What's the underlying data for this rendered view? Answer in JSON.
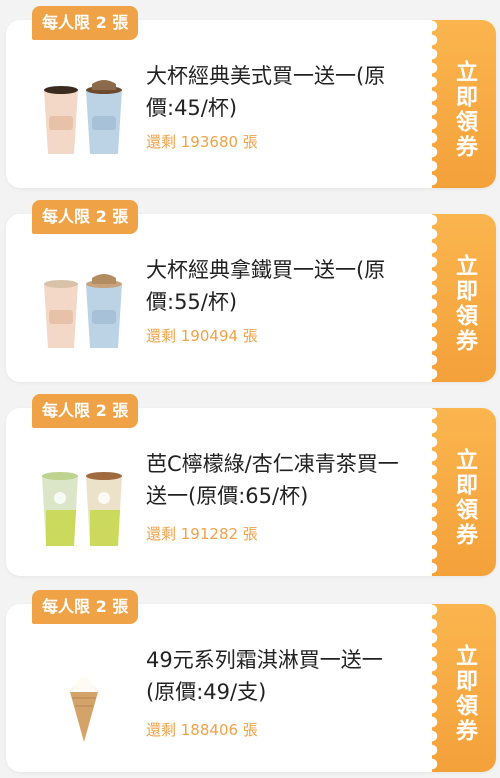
{
  "coupons": [
    {
      "badge": "每人限 2 張",
      "title": "大杯經典美式買一送一(原價:45/杯)",
      "remaining": "還剩 193680 張",
      "cta": "立即領券",
      "image_icon": "coffee-cups-icon"
    },
    {
      "badge": "每人限 2 張",
      "title": "大杯經典拿鐵買一送一(原價:55/杯)",
      "remaining": "還剩 190494 張",
      "cta": "立即領券",
      "image_icon": "latte-cups-icon"
    },
    {
      "badge": "每人限 2 張",
      "title": "芭C檸檬綠/杏仁凍青茶買一送一(原價:65/杯)",
      "remaining": "還剩 191282 張",
      "cta": "立即領券",
      "image_icon": "tea-cups-icon"
    },
    {
      "badge": "每人限 2 張",
      "title": "49元系列霜淇淋買一送一(原價:49/支)",
      "remaining": "還剩 188406 張",
      "cta": "立即領券",
      "image_icon": "ice-cream-cone-icon"
    }
  ],
  "colors": {
    "accent": "#f0a247",
    "ticket": "#f4a13a",
    "background": "#f3f3f3"
  }
}
